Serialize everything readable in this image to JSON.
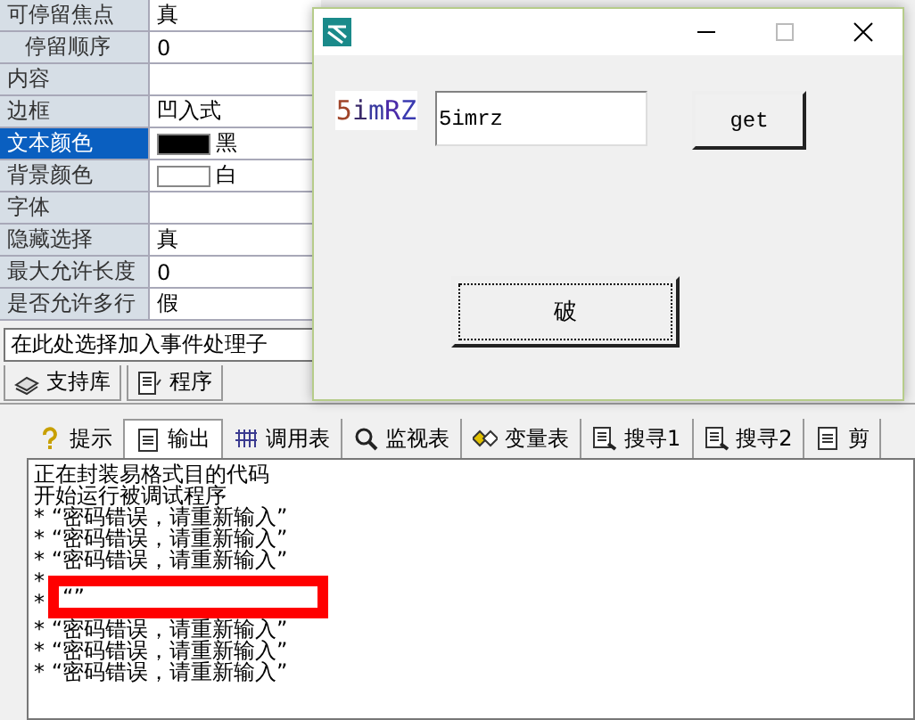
{
  "properties": [
    {
      "name": "可停留焦点",
      "kind": "text",
      "value": "真",
      "selected": false,
      "children": [
        {
          "name": "停留顺序",
          "kind": "text",
          "value": "0",
          "selected": false
        }
      ]
    },
    {
      "name": "内容",
      "kind": "text",
      "selected": false
    },
    {
      "name": "边框",
      "kind": "text",
      "value": "凹入式",
      "selected": false
    },
    {
      "name": "文本颜色",
      "kind": "color",
      "color": "#000000",
      "value": "黑",
      "selected": true
    },
    {
      "name": "背景颜色",
      "kind": "color",
      "color": "#ffffff",
      "value": "白",
      "selected": false
    },
    {
      "name": "字体",
      "kind": "text",
      "selected": false
    },
    {
      "name": "隐藏选择",
      "kind": "text",
      "value": "真",
      "selected": false
    },
    {
      "name": "最大允许长度",
      "kind": "text",
      "value": "0",
      "selected": false
    },
    {
      "name": "是否允许多行",
      "kind": "text",
      "value": "假",
      "selected": false
    }
  ],
  "event_select": {
    "value": "在此处选择加入事件处理子"
  },
  "left_tabs": [
    {
      "label": "支持库",
      "selected": false
    },
    {
      "label": "程序",
      "selected": false
    }
  ],
  "dialog": {
    "captcha": [
      {
        "char": "5",
        "color": "#a0452a"
      },
      {
        "char": "i",
        "color": "#3a2a6a"
      },
      {
        "char": "m",
        "color": "#3a3aa0"
      },
      {
        "char": "R",
        "color": "#4a2aa8"
      },
      {
        "char": "Z",
        "color": "#3a3ab0"
      }
    ],
    "code_field": {
      "value": "5imrz"
    },
    "buttons": [
      {
        "label": "get",
        "focused": false
      },
      {
        "label": "破",
        "focused": true
      }
    ]
  },
  "bottom_tabs": [
    {
      "label": "提示",
      "selected": false
    },
    {
      "label": "输出",
      "selected": true
    },
    {
      "label": "调用表",
      "selected": false
    },
    {
      "label": "监视表",
      "selected": false
    },
    {
      "label": "变量表",
      "selected": false
    },
    {
      "label": "搜寻1",
      "selected": false
    },
    {
      "label": "搜寻2",
      "selected": false
    },
    {
      "label": "剪",
      "selected": false
    }
  ],
  "output": [
    {
      "text": "正在封装易格式目的代码",
      "highlighted": false
    },
    {
      "text": "开始运行被调试程序",
      "highlighted": false
    },
    {
      "text": "* “密码错误，请重新输入”",
      "highlighted": false
    },
    {
      "text": "* “密码错误，请重新输入”",
      "highlighted": false
    },
    {
      "text": "* “密码错误，请重新输入”",
      "highlighted": false
    },
    {
      "text": "*",
      "highlighted": false
    },
    {
      "text": "* “”",
      "highlighted": true
    },
    {
      "text": "* “密码错误，请重新输入”",
      "highlighted": false
    },
    {
      "text": "* “密码错误，请重新输入”",
      "highlighted": false
    },
    {
      "text": "* “密码错误，请重新输入”",
      "highlighted": false
    }
  ]
}
